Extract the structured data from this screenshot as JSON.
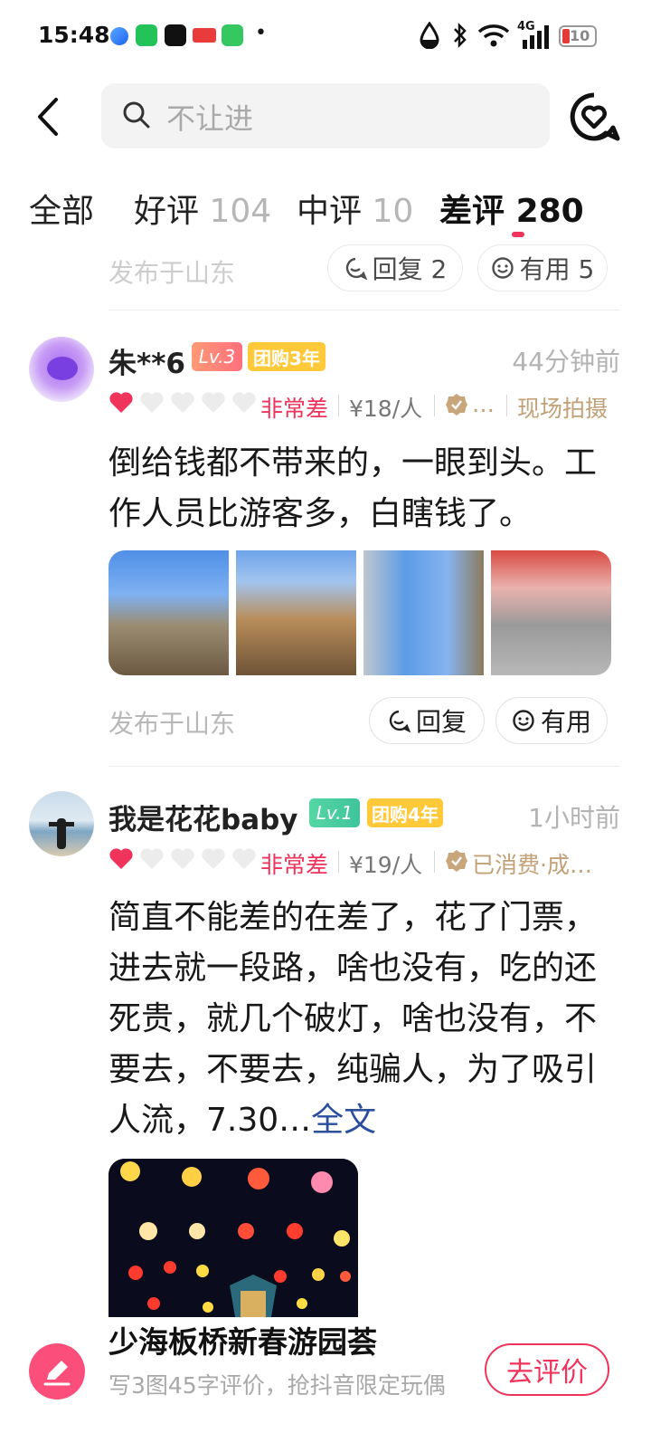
{
  "status_bar": {
    "time": "15:48",
    "apps": [
      "app-blue-icon",
      "phone-icon",
      "tiktok-icon",
      "toutiao-icon",
      "chat-icon"
    ],
    "dot": "•",
    "battery": "10",
    "network": "4G"
  },
  "header": {
    "search_placeholder": "不让进"
  },
  "tabs": [
    {
      "label": "全部",
      "count": ""
    },
    {
      "label": "好评",
      "count": "104"
    },
    {
      "label": "中评",
      "count": "10"
    },
    {
      "label": "差评",
      "count": "280"
    }
  ],
  "previous_review": {
    "location": "发布于山东",
    "reply_label": "回复 2",
    "useful_label": "有用 5"
  },
  "reviews": [
    {
      "user": "朱**6",
      "level": "Lv.3",
      "group": "团购3年",
      "time": "44分钟前",
      "rating_text": "非常差",
      "hearts": 1,
      "price": "¥18/人",
      "badge": "…",
      "tag": "现场拍摄",
      "text": "倒给钱都不带来的，一眼到头。工作人员比游客多，白瞎钱了。",
      "location": "发布于山东",
      "reply_label": "回复",
      "useful_label": "有用",
      "photo_count": 4
    },
    {
      "user": "我是花花baby",
      "level": "Lv.1",
      "group": "团购4年",
      "time": "1小时前",
      "rating_text": "非常差",
      "hearts": 1,
      "price": "¥19/人",
      "badge": "已消费·成…",
      "text": "简直不能差的在差了，花了门票，进去就一段路，啥也没有，吃的还死贵，就几个破灯，啥也没有，不要去，不要去，纯骗人，为了吸引人流，7.30…",
      "more": "全文"
    }
  ],
  "bottom": {
    "title": "少海板桥新春游园荟",
    "subtitle": "写3图45字评价，抢抖音限定玩偶",
    "button": "去评价"
  },
  "colors": {
    "accent": "#f0335b",
    "gold": "#c2a176",
    "link": "#2b4f9e"
  }
}
